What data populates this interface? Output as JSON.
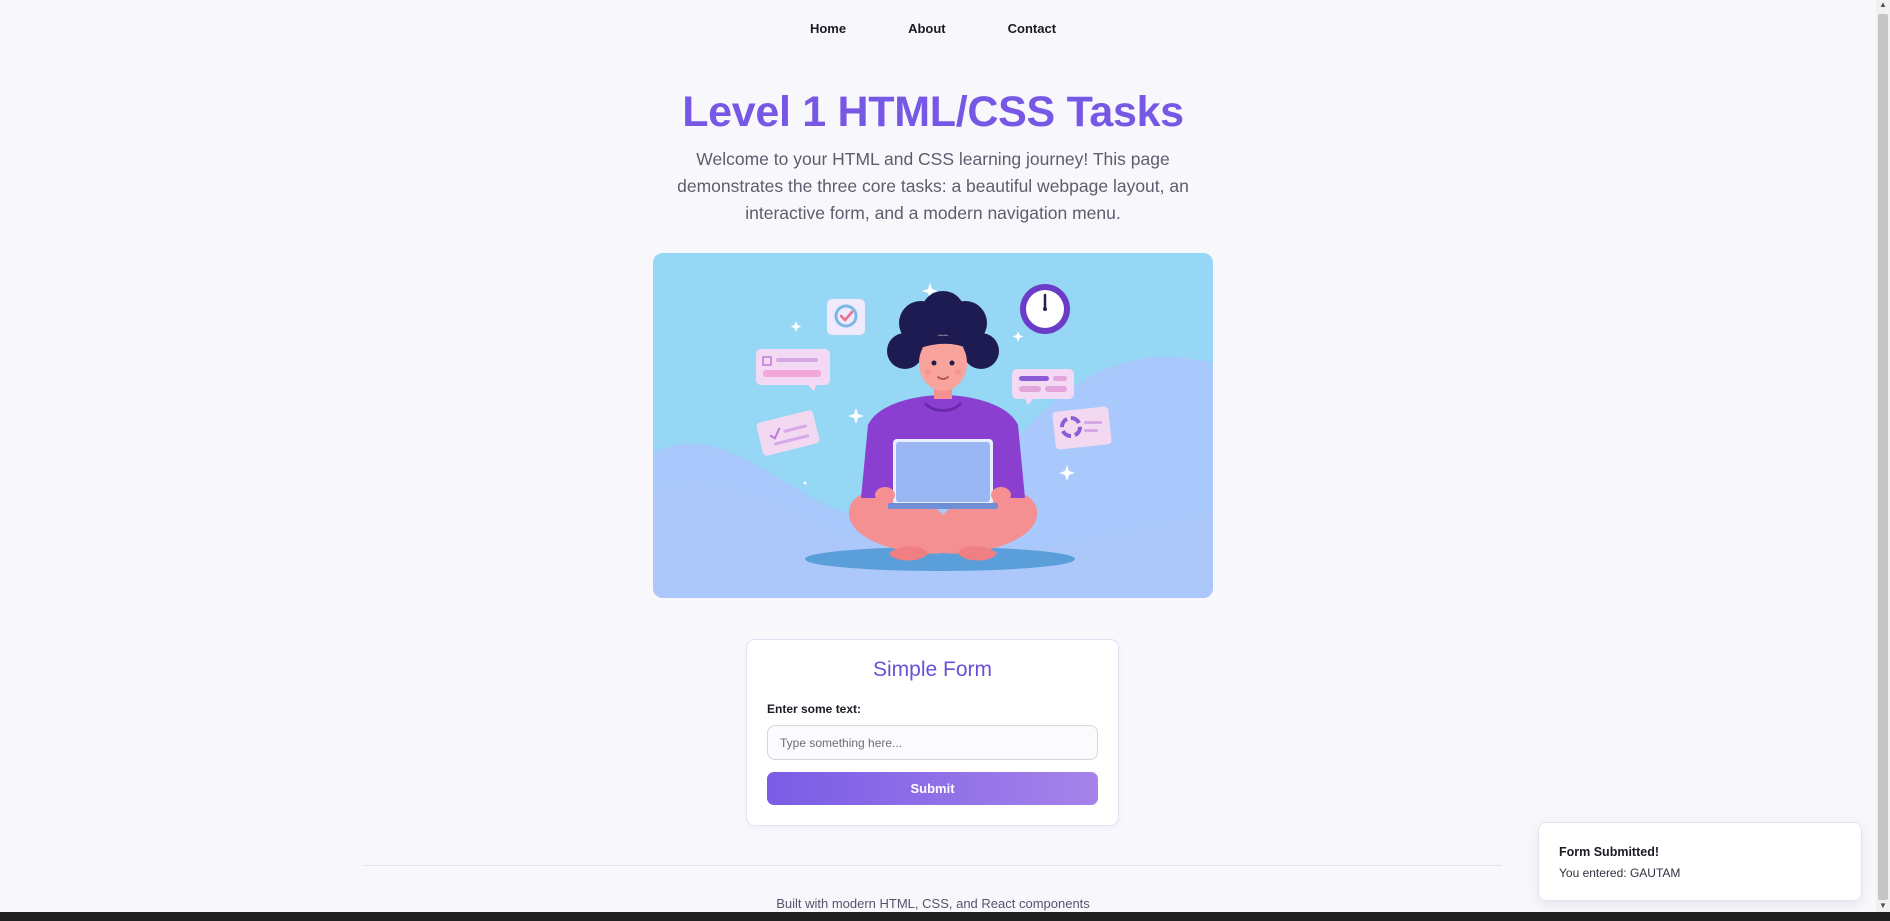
{
  "nav": {
    "items": [
      {
        "label": "Home"
      },
      {
        "label": "About"
      },
      {
        "label": "Contact"
      }
    ]
  },
  "hero": {
    "title": "Level 1 HTML/CSS Tasks",
    "description": "Welcome to your HTML and CSS learning journey! This page demonstrates the three core tasks: a beautiful webpage layout, an interactive form, and a modern navigation menu."
  },
  "illustration": {
    "subject": "person-with-laptop-illustration"
  },
  "form": {
    "title": "Simple Form",
    "label": "Enter some text:",
    "placeholder": "Type something here...",
    "value": "",
    "submit_label": "Submit"
  },
  "footer": {
    "text": "Built with modern HTML, CSS, and React components"
  },
  "toast": {
    "title": "Form Submitted!",
    "message": "You entered: GAUTAM"
  },
  "colors": {
    "accent": "#7658e4",
    "background": "#f8f7fc",
    "button_gradient_start": "#7a5ce6",
    "button_gradient_end": "#a583ea"
  }
}
